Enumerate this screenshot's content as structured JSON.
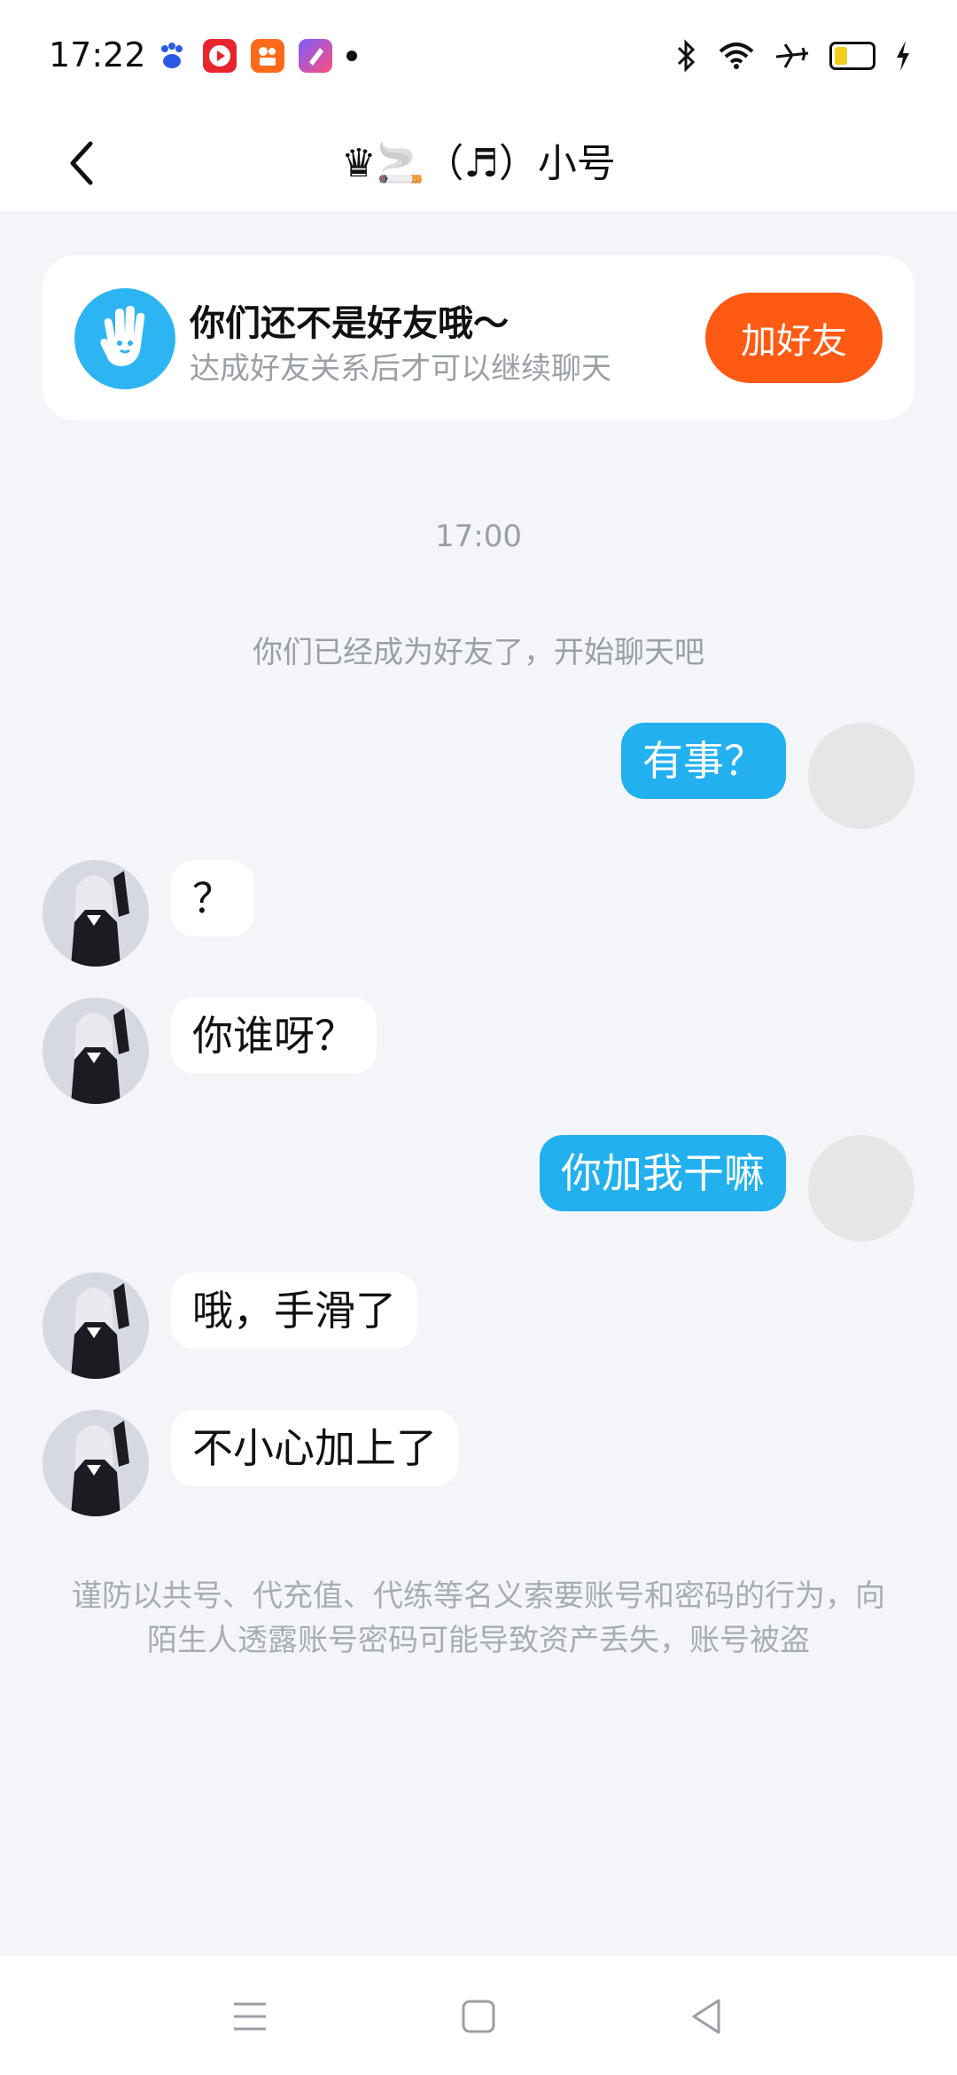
{
  "status_bar": {
    "time": "17:22",
    "app_icons": [
      "baidu-app-icon",
      "video-app-icon",
      "kuaishou-app-icon",
      "pinduoduo-app-icon"
    ],
    "system_icons": [
      "bluetooth-icon",
      "wifi-icon",
      "airplane-icon",
      "battery-icon",
      "charging-icon"
    ]
  },
  "header": {
    "title": "♛🚬（♬）小号"
  },
  "friend_card": {
    "title": "你们还不是好友哦～",
    "subtitle": "达成好友关系后才可以继续聊天",
    "button_label": "加好友"
  },
  "chat": {
    "timestamp": "17:00",
    "system_message": "你们已经成为好友了，开始聊天吧",
    "messages": [
      {
        "sender": "me",
        "text": "有事？"
      },
      {
        "sender": "other",
        "text": "？"
      },
      {
        "sender": "other",
        "text": "你谁呀？"
      },
      {
        "sender": "me",
        "text": "你加我干嘛"
      },
      {
        "sender": "other",
        "text": "哦，手滑了"
      },
      {
        "sender": "other",
        "text": "不小心加上了"
      }
    ],
    "warning": "谨防以共号、代充值、代练等名义索要账号和密码的行为，向陌生人透露账号密码可能导致资产丢失，账号被盗"
  },
  "colors": {
    "accent_blue": "#22b0ef",
    "add_button": "#ff5a13",
    "background": "#f3f5f9"
  }
}
